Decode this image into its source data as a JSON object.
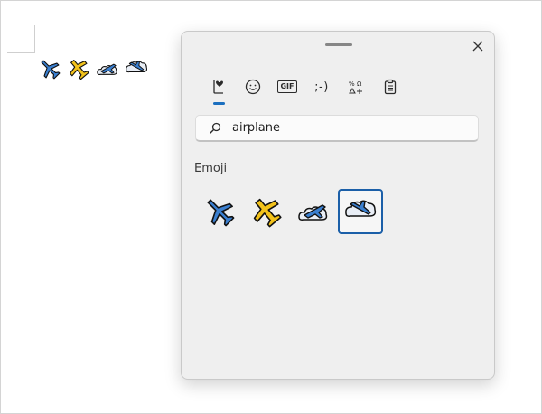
{
  "document": {
    "inserted_emoji": [
      "airplane",
      "small-airplane",
      "airplane-departure",
      "airplane-arrival"
    ]
  },
  "panel": {
    "tabs": [
      {
        "name": "tab-recent",
        "icon": "heart-clock-icon"
      },
      {
        "name": "tab-emoji",
        "icon": "smiley-icon"
      },
      {
        "name": "tab-gif",
        "label": "GIF"
      },
      {
        "name": "tab-kaomoji",
        "label": ";-)"
      },
      {
        "name": "tab-symbols",
        "icon": "symbols-icon"
      },
      {
        "name": "tab-clipboard",
        "icon": "clipboard-icon"
      }
    ],
    "active_tab": "tab-recent",
    "search": {
      "value": "airplane"
    },
    "section_label": "Emoji",
    "results": [
      {
        "name": "emoji-airplane",
        "selected": false
      },
      {
        "name": "emoji-small-airplane",
        "selected": false
      },
      {
        "name": "emoji-airplane-departure",
        "selected": false
      },
      {
        "name": "emoji-airplane-arrival",
        "selected": true
      }
    ]
  },
  "colors": {
    "accent": "#1b6fbf",
    "plane_blue": "#3a7fd0",
    "plane_yellow": "#f2c21b",
    "cloud": "#e9eef6"
  }
}
